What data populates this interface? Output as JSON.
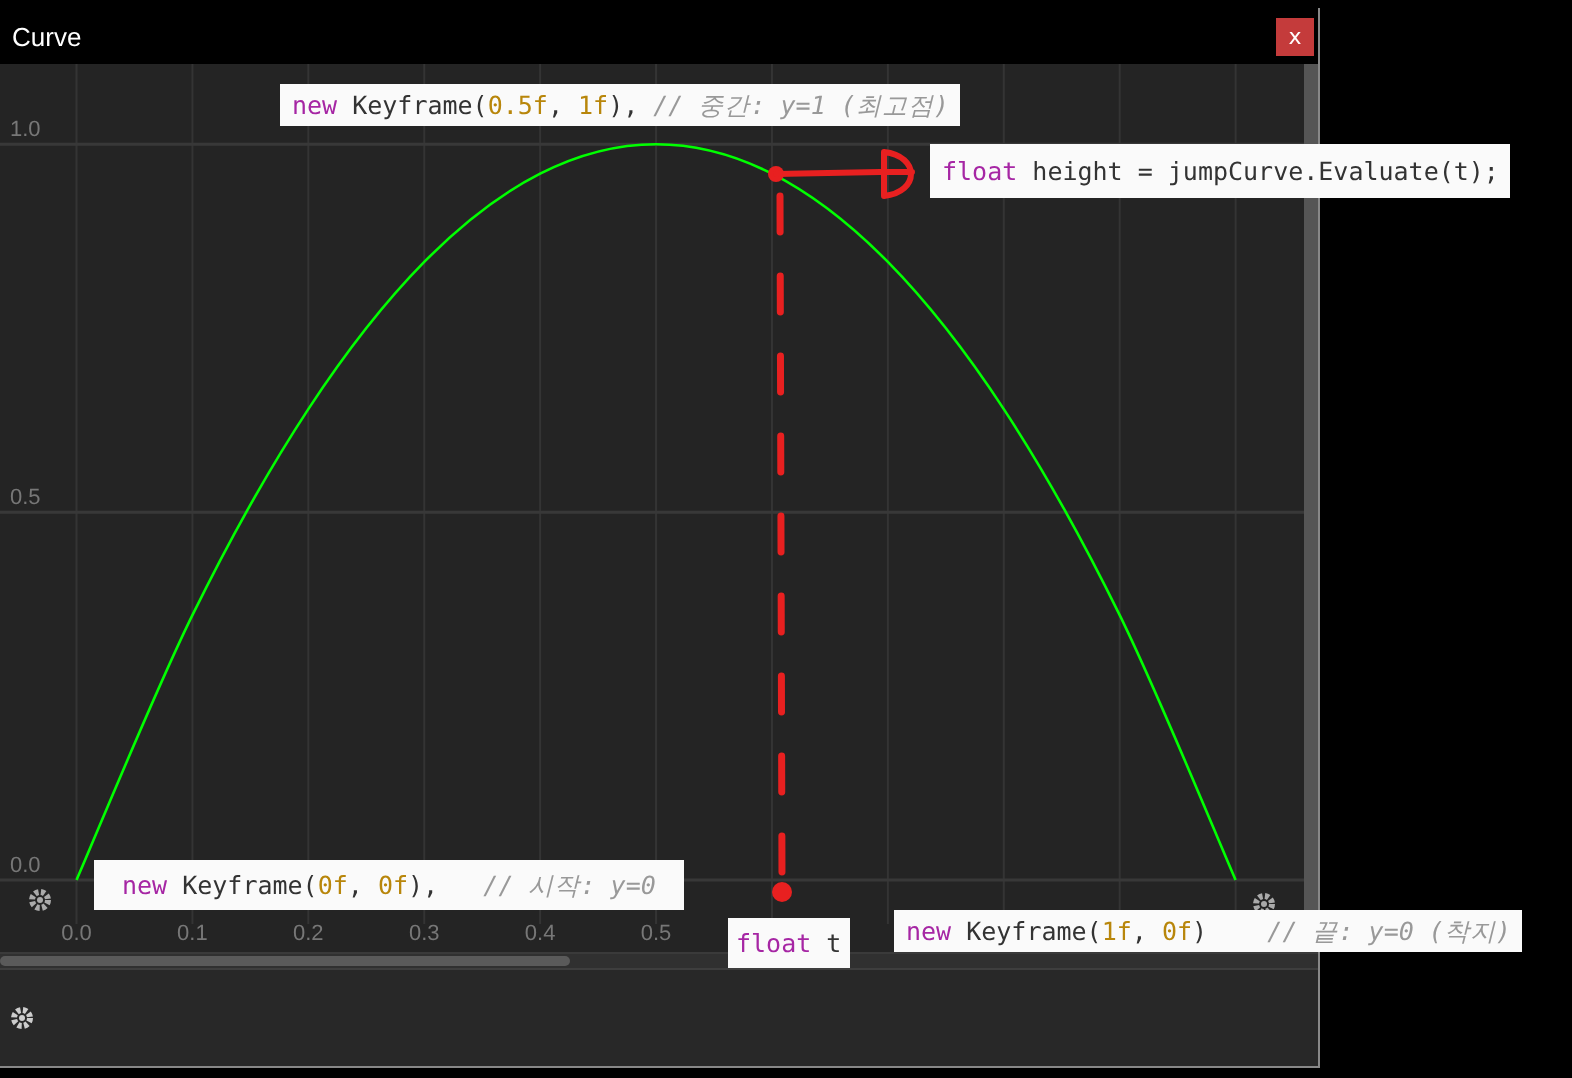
{
  "window": {
    "title": "Curve",
    "close": "x"
  },
  "curve_editor": {
    "chart_data": {
      "type": "line",
      "x": [
        0,
        0.1,
        0.2,
        0.3,
        0.4,
        0.5,
        0.6,
        0.7,
        0.8,
        0.9,
        1
      ],
      "series": [
        {
          "color": "#00ff00",
          "values": [
            0,
            0.36,
            0.64,
            0.84,
            0.96,
            1,
            0.96,
            0.84,
            0.64,
            0.36,
            0
          ]
        }
      ],
      "xlim": [
        -0.066,
        1.059
      ],
      "ylim": [
        -0.269,
        1.196
      ],
      "grid": true,
      "xticks": [
        {
          "value": 0,
          "label": "0.0"
        },
        {
          "value": 0.1,
          "label": "0.1"
        },
        {
          "value": 0.2,
          "label": "0.2"
        },
        {
          "value": 0.3,
          "label": "0.3"
        },
        {
          "value": 0.4,
          "label": "0.4"
        },
        {
          "value": 0.5,
          "label": "0.5"
        }
      ],
      "yticks": [
        {
          "value": 0,
          "label": "0.0"
        },
        {
          "value": 0.5,
          "label": "0.5"
        },
        {
          "value": 1,
          "label": "1.0"
        }
      ]
    }
  },
  "annotations": [
    {
      "kind": "peak",
      "segments": [
        {
          "kind": "keyword",
          "text": "new"
        },
        {
          "kind": "plain",
          "text": " Keyframe("
        },
        {
          "kind": "number",
          "text": "0.5f"
        },
        {
          "kind": "plain",
          "text": ", "
        },
        {
          "kind": "number",
          "text": "1f"
        },
        {
          "kind": "plain",
          "text": "), "
        },
        {
          "kind": "comment",
          "text": "// 중간: y=1 (최고점)"
        }
      ]
    },
    {
      "kind": "evaluate",
      "segments": [
        {
          "kind": "keyword",
          "text": "float"
        },
        {
          "kind": "plain",
          "text": " height = jumpCurve.Evaluate(t);"
        }
      ]
    },
    {
      "kind": "start",
      "segments": [
        {
          "kind": "keyword",
          "text": "new"
        },
        {
          "kind": "plain",
          "text": " Keyframe("
        },
        {
          "kind": "number",
          "text": "0f"
        },
        {
          "kind": "plain",
          "text": ", "
        },
        {
          "kind": "number",
          "text": "0f"
        },
        {
          "kind": "plain",
          "text": "),   "
        },
        {
          "kind": "comment",
          "text": "// 시작: y=0"
        }
      ]
    },
    {
      "kind": "time",
      "segments": [
        {
          "kind": "keyword",
          "text": "float"
        },
        {
          "kind": "plain",
          "text": " t"
        }
      ]
    },
    {
      "kind": "end",
      "segments": [
        {
          "kind": "keyword",
          "text": "new"
        },
        {
          "kind": "plain",
          "text": " Keyframe("
        },
        {
          "kind": "number",
          "text": "1f"
        },
        {
          "kind": "plain",
          "text": ", "
        },
        {
          "kind": "number",
          "text": "0f"
        },
        {
          "kind": "plain",
          "text": ")    "
        },
        {
          "kind": "comment",
          "text": "// 끝: y=0 (착지)"
        }
      ]
    }
  ]
}
